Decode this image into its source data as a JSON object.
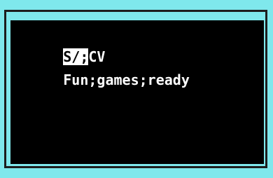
{
  "screen": {
    "line1_selected": "S/;",
    "line1_rest": "CV",
    "line2": "Fun;games;ready"
  },
  "colors": {
    "outer_bg": "#7fe8ec",
    "terminal_bg": "#000000",
    "text": "#ffffff",
    "selection_bg": "#ffffff",
    "selection_text": "#000000"
  }
}
